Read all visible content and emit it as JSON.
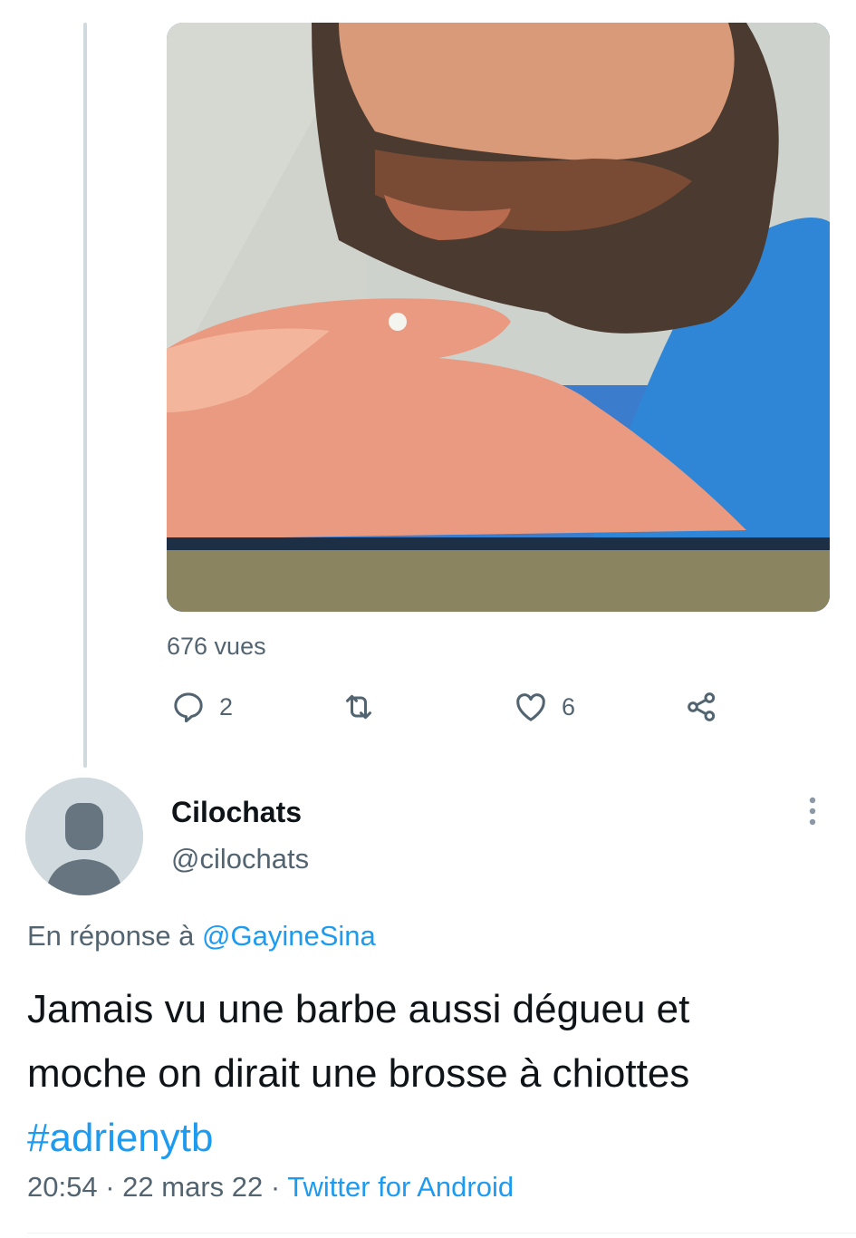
{
  "previous_tweet": {
    "views": "676 vues",
    "actions": {
      "reply_count": "2",
      "retweet_count": "",
      "like_count": "6"
    }
  },
  "tweet": {
    "display_name": "Cilochats",
    "handle": "@cilochats",
    "reply_prefix": "En réponse à",
    "reply_to": "@GayineSina",
    "text_line1": "Jamais vu une barbe aussi dégueu et",
    "text_line2": "moche on dirait une brosse à chiottes",
    "hashtag": "#adrienytb",
    "time": "20:54",
    "separator": "·",
    "date": "22 mars 22",
    "source": "Twitter for Android"
  },
  "icons": {
    "reply": "speech-bubble-icon",
    "retweet": "retweet-icon",
    "like": "heart-icon",
    "share": "share-icon",
    "more": "vertical-dots-icon",
    "avatar": "default-avatar-icon"
  },
  "colors": {
    "link": "#1d9bf0",
    "secondary_text": "#536471",
    "thread_line": "#cfd9de"
  }
}
